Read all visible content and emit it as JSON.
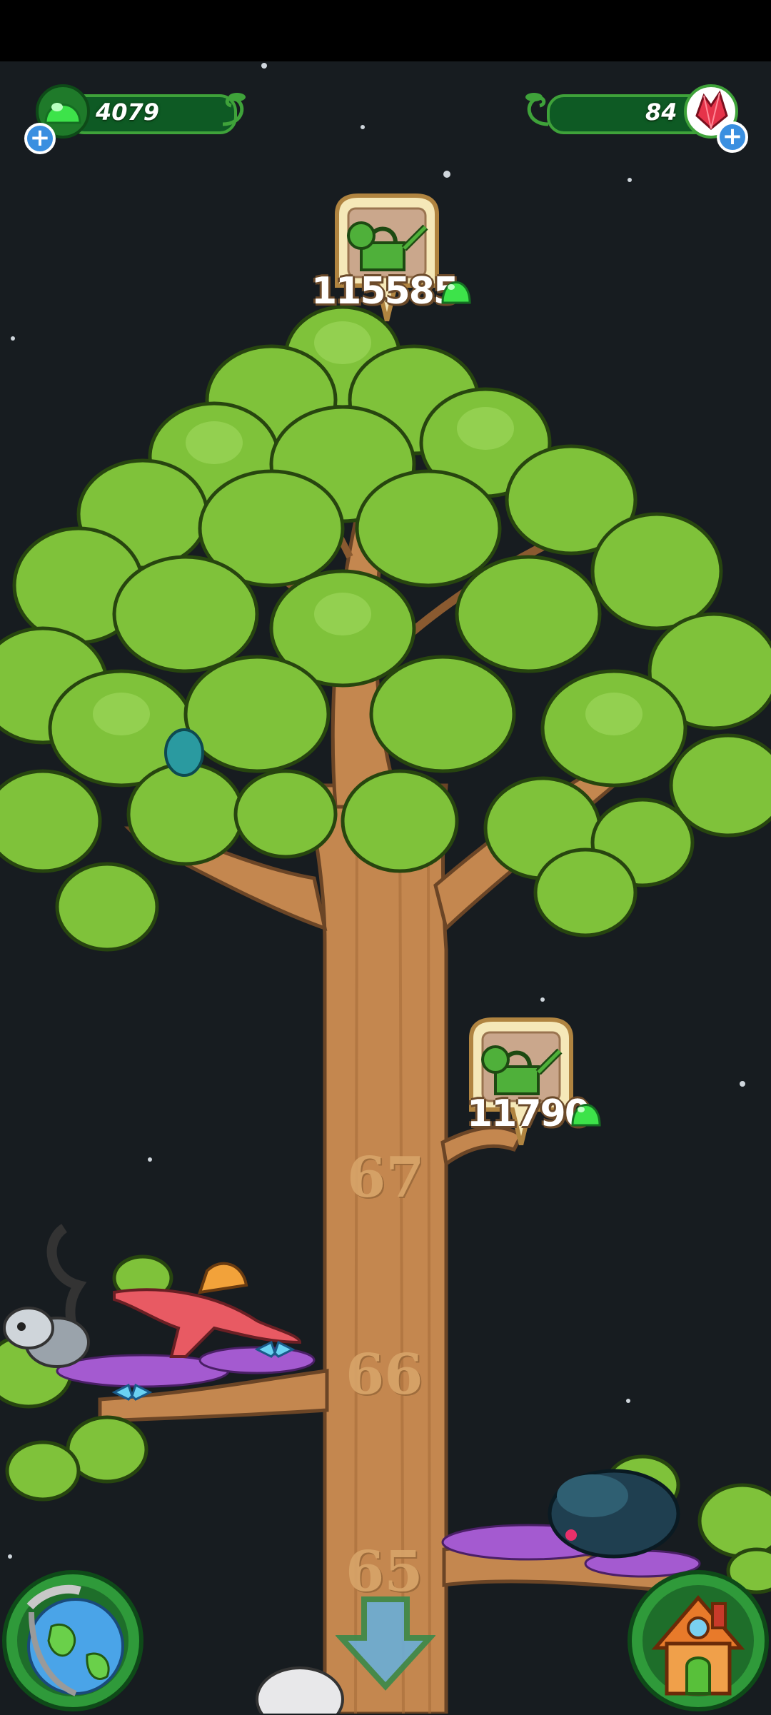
{
  "hud": {
    "gems_value": "4079",
    "crystals_value": "84",
    "gem_icon": "green-gumdrop-icon",
    "crystal_icon": "red-crystal-icon",
    "plus_icon": "plus-icon"
  },
  "upgrades": [
    {
      "icon": "watering-can-icon",
      "price": "115585",
      "currency_icon": "green-gumdrop-icon"
    },
    {
      "icon": "watering-can-icon",
      "price": "11790",
      "currency_icon": "green-gumdrop-icon"
    }
  ],
  "levels": [
    "67",
    "66",
    "65"
  ],
  "nav": {
    "world_icon": "globe-icon",
    "scroll_icon": "down-arrow-icon",
    "home_icon": "house-icon"
  },
  "colors": {
    "background": "#171c20",
    "leaf": "#7fc23a",
    "trunk": "#c4874f",
    "bar": "#0e5a24",
    "accent_blue": "#3a8fe0"
  }
}
